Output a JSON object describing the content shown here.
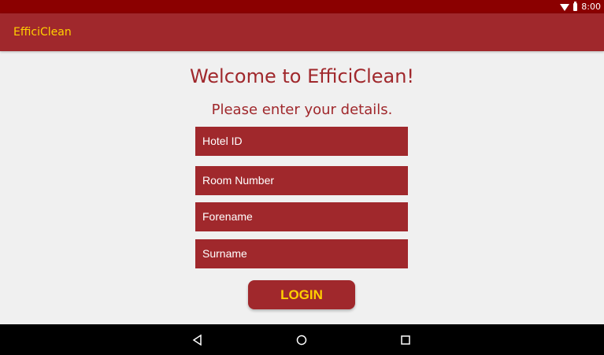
{
  "status_bar": {
    "time": "8:00",
    "icons": [
      "wifi-icon",
      "battery-icon"
    ]
  },
  "app_bar": {
    "title": "EfficiClean"
  },
  "main": {
    "welcome": "Welcome to EfficiClean!",
    "subtitle": "Please enter your details.",
    "fields": [
      {
        "placeholder": "Hotel ID",
        "value": ""
      },
      {
        "placeholder": "Room Number",
        "value": ""
      },
      {
        "placeholder": "Forename",
        "value": ""
      },
      {
        "placeholder": "Surname",
        "value": ""
      }
    ],
    "login_label": "LOGIN"
  },
  "nav_bar": {
    "buttons": [
      "back-icon",
      "home-icon",
      "recents-icon"
    ]
  },
  "colors": {
    "status_bar": "#8b0000",
    "primary": "#a0282c",
    "accent": "#ffd000",
    "background": "#f0f0f0",
    "nav_bar": "#000000"
  }
}
